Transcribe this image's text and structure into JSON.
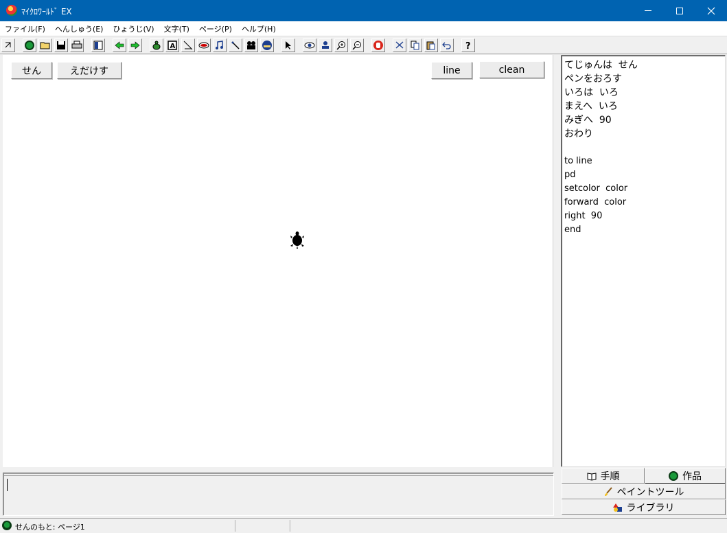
{
  "window": {
    "title": "ﾏｲｸﾛﾜｰﾙﾄﾞ EX"
  },
  "menu": [
    "ファイル(F)",
    "へんしゅう(E)",
    "ひょうじ(V)",
    "文字(T)",
    "ページ(P)",
    "ヘルプ(H)"
  ],
  "toolbar": {
    "icons": [
      "pointer-arrow",
      "globe",
      "open-folder",
      "save-disk",
      "printer",
      "layout-panel",
      "arrow-left",
      "arrow-right",
      "turtle-new",
      "text-box",
      "line-ruler",
      "eye-shape",
      "music-note",
      "pen-tool",
      "film-camera",
      "face-ball",
      "select-arrow",
      "eye",
      "stamp",
      "zoom-in",
      "zoom-out",
      "stop-hand",
      "scissors",
      "copy",
      "paste",
      "undo",
      "help"
    ]
  },
  "canvas": {
    "buttons": {
      "sen": "せん",
      "edakesu": "えだけす",
      "line": "line",
      "clean": "clean"
    }
  },
  "script": {
    "lines": [
      "てじゅんは  せん",
      "ペンをおろす",
      "いろは  いろ",
      "まえへ  いろ",
      "みぎへ  90",
      "おわり",
      "",
      "to line",
      "pd",
      "setcolor  color",
      "forward  color",
      "right  90",
      "end"
    ]
  },
  "panel_tabs": {
    "steps": "手順",
    "works": "作品",
    "paint": "ペイントツール",
    "library": "ライブラリ"
  },
  "status": {
    "text": "せんのもと: ページ1"
  },
  "colors": {
    "titlebar": "#0063b1",
    "accent_green": "#1a9a3a"
  }
}
